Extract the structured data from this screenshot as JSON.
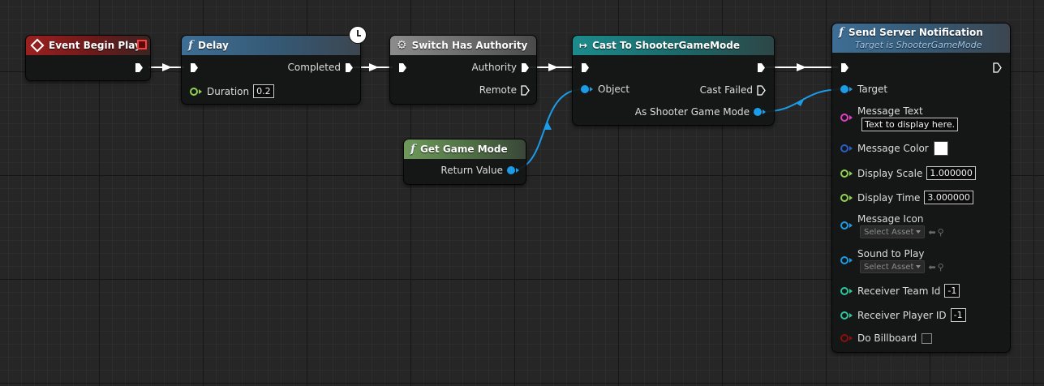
{
  "nodes": {
    "event_begin_play": {
      "title": "Event Begin Play"
    },
    "delay": {
      "title": "Delay",
      "out_exec_label": "Completed",
      "duration_label": "Duration",
      "duration_value": "0.2"
    },
    "switch_has_authority": {
      "title": "Switch Has Authority",
      "authority_label": "Authority",
      "remote_label": "Remote"
    },
    "cast": {
      "title": "Cast To ShooterGameMode",
      "object_label": "Object",
      "cast_failed_label": "Cast Failed",
      "as_label": "As Shooter Game Mode"
    },
    "get_game_mode": {
      "title": "Get Game Mode",
      "return_label": "Return Value"
    },
    "send_notification": {
      "title": "Send Server Notification",
      "subtitle": "Target is ShooterGameMode",
      "target_label": "Target",
      "message_text_label": "Message Text",
      "message_text_value": "Text to display here.",
      "message_color_label": "Message Color",
      "message_color_value": "#ffffff",
      "display_scale_label": "Display Scale",
      "display_scale_value": "1.000000",
      "display_time_label": "Display Time",
      "display_time_value": "3.000000",
      "message_icon_label": "Message Icon",
      "message_icon_asset": "Select Asset",
      "sound_label": "Sound to Play",
      "sound_asset": "Select Asset",
      "receiver_team_label": "Receiver Team Id",
      "receiver_team_value": "-1",
      "receiver_player_label": "Receiver Player ID",
      "receiver_player_value": "-1",
      "billboard_label": "Do Billboard"
    }
  },
  "colors": {
    "exec_wire": "#ffffff",
    "object_wire": "#1b9ce8",
    "event_header": "#9c2020",
    "function_header": "#3e6e95",
    "macro_header": "#8c8c8c",
    "cast_header": "#1c8b8c",
    "pure_header": "#6f9a5b"
  },
  "icons": {
    "event": "event-diamond-icon",
    "function": "function-f-icon",
    "macro": "gear-icon",
    "cast": "cast-arrow-icon",
    "latent": "clock-icon"
  }
}
